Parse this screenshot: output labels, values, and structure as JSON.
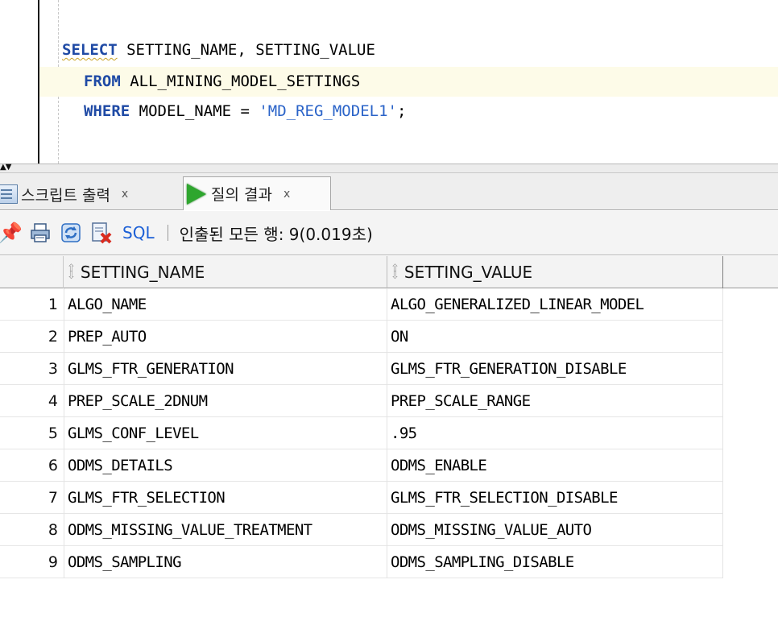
{
  "editor": {
    "line1": {
      "kw": "SELECT",
      "rest": " SETTING_NAME, SETTING_VALUE"
    },
    "line2": {
      "kw": "FROM",
      "rest": " ALL_MINING_MODEL_SETTINGS"
    },
    "line3": {
      "kw": "WHERE",
      "mid": " MODEL_NAME = ",
      "str": "'MD_REG_MODEL1'",
      "end": ";"
    }
  },
  "tabs": [
    {
      "label": "스크립트 출력",
      "close": "x",
      "icon": "document-icon"
    },
    {
      "label": "질의 결과",
      "close": "x",
      "icon": "play-icon"
    }
  ],
  "toolbar": {
    "icons": [
      "pin-icon",
      "print-icon",
      "refresh-icon",
      "clear-icon"
    ],
    "sql_label": "SQL",
    "separator": "|",
    "status": "인출된 모든 행: 9(0.019초)"
  },
  "grid": {
    "columns": [
      "SETTING_NAME",
      "SETTING_VALUE"
    ],
    "rows": [
      {
        "n": "1",
        "name": "ALGO_NAME",
        "value": "ALGO_GENERALIZED_LINEAR_MODEL"
      },
      {
        "n": "2",
        "name": "PREP_AUTO",
        "value": "ON"
      },
      {
        "n": "3",
        "name": "GLMS_FTR_GENERATION",
        "value": "GLMS_FTR_GENERATION_DISABLE"
      },
      {
        "n": "4",
        "name": "PREP_SCALE_2DNUM",
        "value": "PREP_SCALE_RANGE"
      },
      {
        "n": "5",
        "name": "GLMS_CONF_LEVEL",
        "value": ".95"
      },
      {
        "n": "6",
        "name": "ODMS_DETAILS",
        "value": "ODMS_ENABLE"
      },
      {
        "n": "7",
        "name": "GLMS_FTR_SELECTION",
        "value": "GLMS_FTR_SELECTION_DISABLE"
      },
      {
        "n": "8",
        "name": "ODMS_MISSING_VALUE_TREATMENT",
        "value": "ODMS_MISSING_VALUE_AUTO"
      },
      {
        "n": "9",
        "name": "ODMS_SAMPLING",
        "value": "ODMS_SAMPLING_DISABLE"
      }
    ]
  }
}
